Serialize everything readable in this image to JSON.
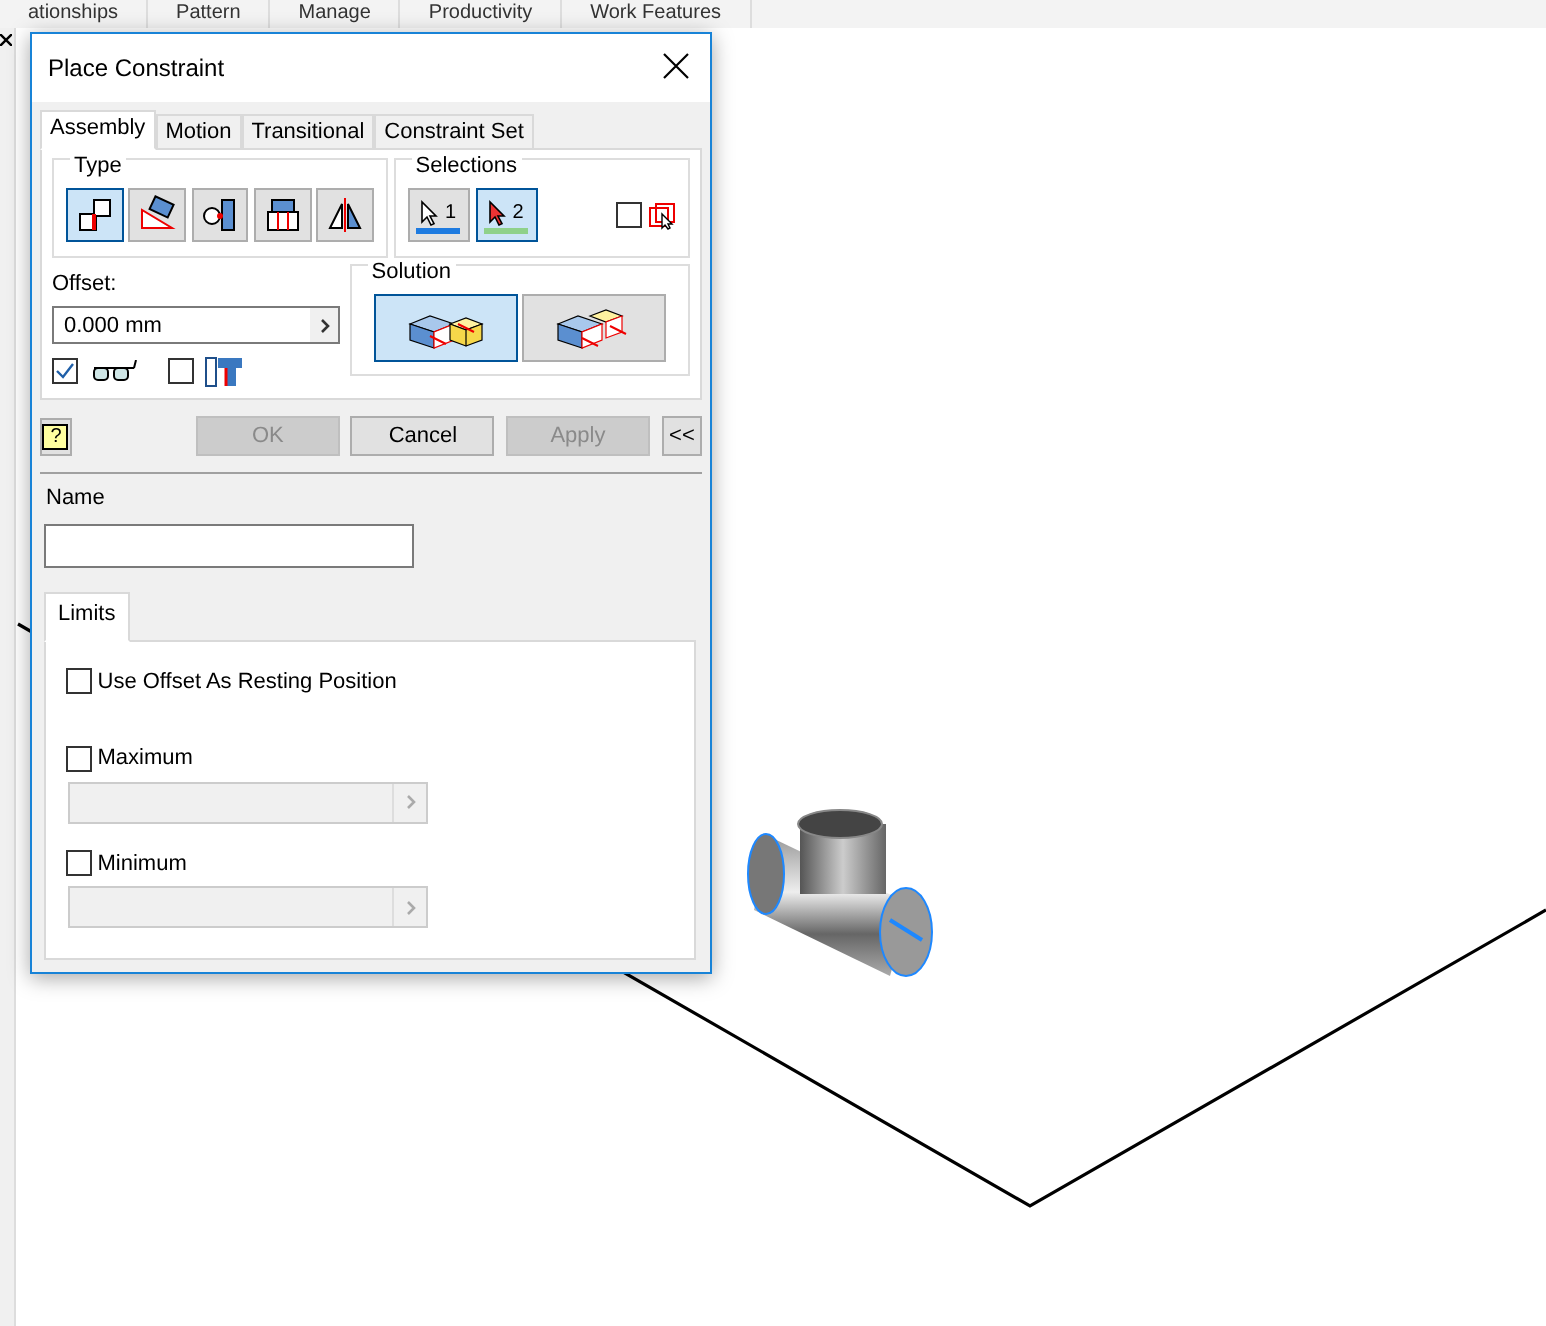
{
  "ribbon_tabs": [
    "ationships",
    "Pattern",
    "Manage",
    "Productivity",
    "Work Features"
  ],
  "dialog": {
    "title": "Place Constraint",
    "tabs": [
      {
        "label": "Assembly",
        "selected": true
      },
      {
        "label": "Motion",
        "selected": false
      },
      {
        "label": "Transitional",
        "selected": false
      },
      {
        "label": "Constraint Set",
        "selected": false
      }
    ],
    "type": {
      "label": "Type",
      "items": [
        {
          "kind": "mate",
          "selected": true
        },
        {
          "kind": "angle",
          "selected": false
        },
        {
          "kind": "tangent",
          "selected": false
        },
        {
          "kind": "insert",
          "selected": false
        },
        {
          "kind": "symmetry",
          "selected": false
        }
      ]
    },
    "selections": {
      "label": "Selections",
      "items": [
        {
          "label": "1",
          "selected": false,
          "color": "#1e7be0"
        },
        {
          "label": "2",
          "selected": true,
          "color": "#8fd18a"
        }
      ],
      "pick_part_first": {
        "checked": false
      }
    },
    "offset": {
      "label": "Offset:",
      "value": "0.000 mm"
    },
    "show_preview": {
      "checked": true
    },
    "predict_offset": {
      "checked": false
    },
    "solution": {
      "label": "Solution",
      "options": [
        {
          "kind": "mate",
          "selected": true
        },
        {
          "kind": "flush",
          "selected": false
        }
      ]
    },
    "buttons": [
      {
        "label": "OK",
        "disabled": true
      },
      {
        "label": "Cancel",
        "disabled": false
      },
      {
        "label": "Apply",
        "disabled": true
      }
    ],
    "help_button": "?",
    "collapse_button": "<<",
    "name_label": "Name",
    "limits_tab": {
      "label": "Limits",
      "selected": true
    },
    "use_offset": {
      "label": "Use Offset As Resting Position",
      "checked": false
    },
    "limits": [
      {
        "label": "Maximum",
        "checked": false,
        "disabled": true
      },
      {
        "label": "Minimum",
        "checked": false,
        "disabled": true
      }
    ]
  }
}
